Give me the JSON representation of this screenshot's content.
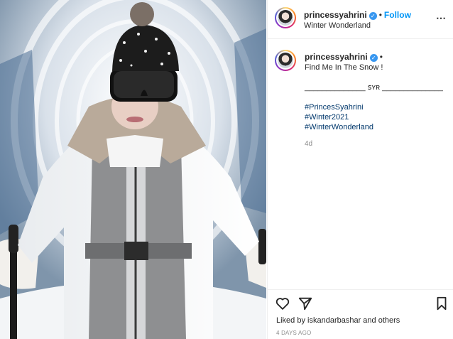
{
  "post": {
    "username": "princessyahrini",
    "location": "Winter Wonderland",
    "follow_label": "Follow",
    "separator": "•",
    "more_icon": "⋯",
    "verified_mark": "✓",
    "caption_text": "Find Me In The Snow !",
    "caption_signature": "______________ ꜱʏʀ ______________",
    "hashtags": [
      "#PrincesSyahrini",
      "#Winter2021",
      "#WinterWonderland"
    ],
    "age": "4d",
    "likes_text": "Liked by iskandarbashar and others",
    "time_ago": "4 DAYS AGO"
  },
  "icons": {
    "more": "more-options-icon",
    "like": "heart-icon",
    "share": "paper-plane-icon",
    "save": "bookmark-icon",
    "verified": "verified-badge-icon"
  },
  "colors": {
    "accent": "#0095f6",
    "hashtag": "#00376b",
    "muted": "#8e8e8e",
    "text": "#262626"
  }
}
